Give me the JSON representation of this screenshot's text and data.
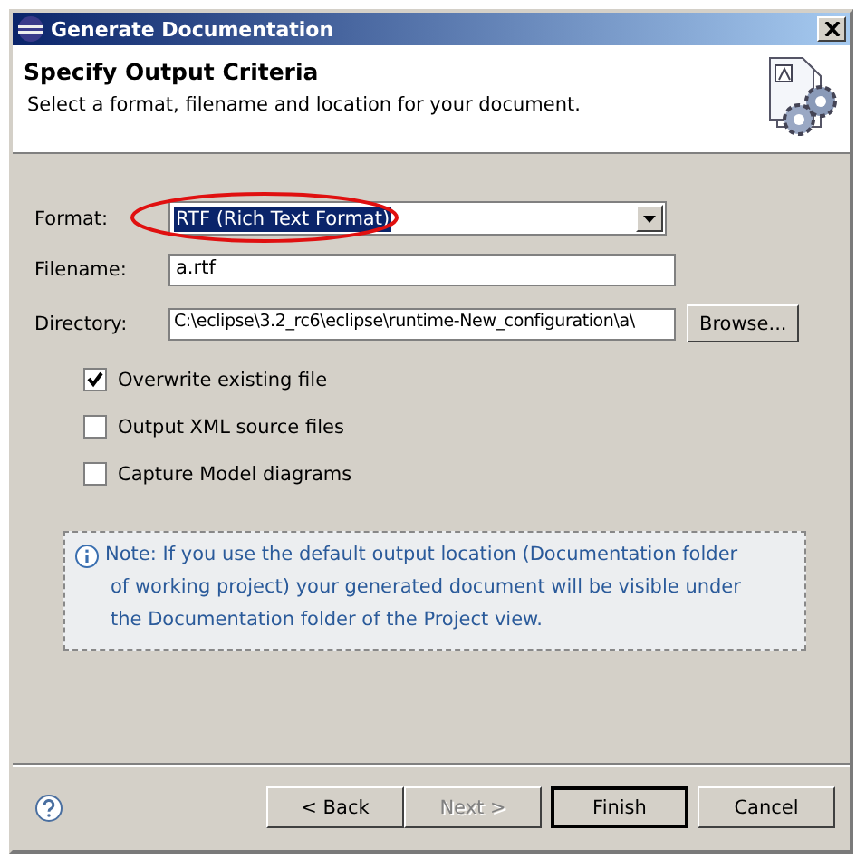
{
  "window": {
    "title": "Generate Documentation"
  },
  "header": {
    "title": "Specify Output Criteria",
    "description": "Select a format, filename and location for your document."
  },
  "fields": [
    {
      "kind": "combo",
      "label": "Format:",
      "value": "RTF (Rich Text Format)",
      "highlighted": true
    },
    {
      "kind": "text",
      "label": "Filename:",
      "value": "a.rtf"
    },
    {
      "kind": "browse",
      "label": "Directory:",
      "value": "C:\\eclipse\\3.2_rc6\\eclipse\\runtime-New_configuration\\a\\",
      "button": "Browse..."
    }
  ],
  "options": [
    {
      "label": "Overwrite existing file",
      "checked": true
    },
    {
      "label": "Output XML source files",
      "checked": false
    },
    {
      "label": "Capture Model diagrams",
      "checked": false
    }
  ],
  "note": {
    "lines": [
      "Note: If you use the default output location (Documentation folder",
      "of working project) your generated document will be visible under",
      "the Documentation folder of the Project view."
    ]
  },
  "buttons": [
    {
      "label": "< Back",
      "disabled": false,
      "default": false
    },
    {
      "label": "Next >",
      "disabled": true,
      "default": false
    },
    {
      "label": "Finish",
      "disabled": false,
      "default": true
    },
    {
      "label": "Cancel",
      "disabled": false,
      "default": false
    }
  ]
}
